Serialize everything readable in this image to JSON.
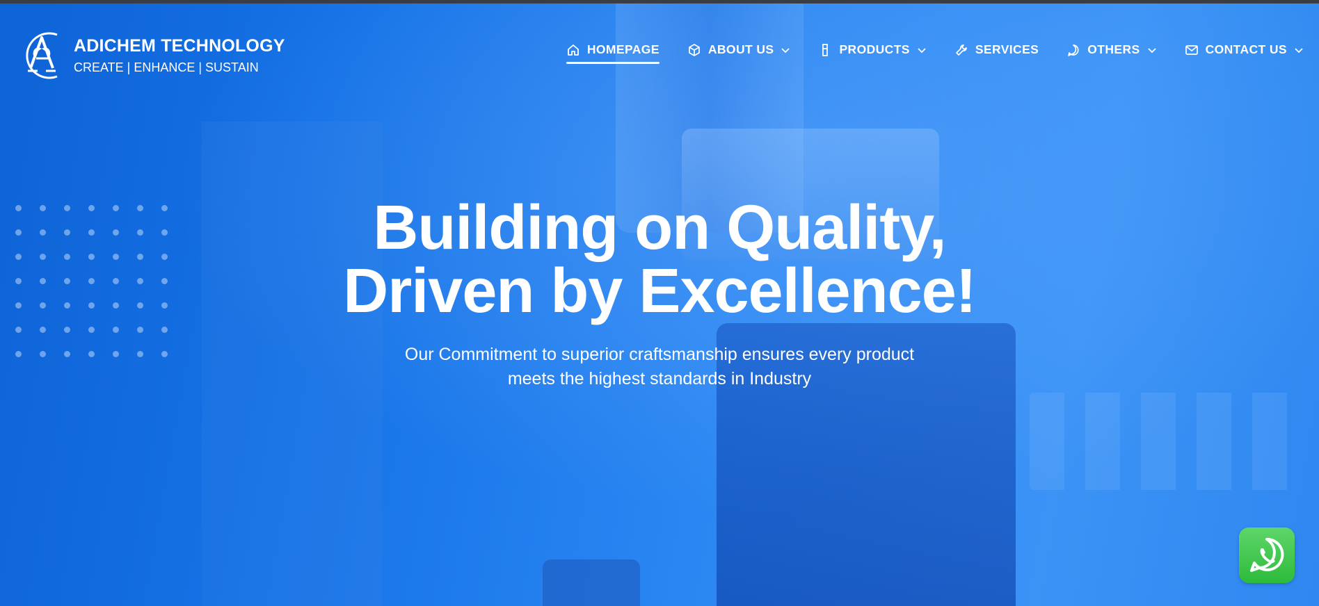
{
  "brand": {
    "name": "ADICHEM TECHNOLOGY",
    "tagline": "CREATE | ENHANCE | SUSTAIN",
    "logo_icon": "adichem-logo-icon"
  },
  "nav": {
    "items": [
      {
        "label": "HOMEPAGE",
        "icon": "home-icon",
        "dropdown": false,
        "active": true
      },
      {
        "label": "ABOUT US",
        "icon": "cube-icon",
        "dropdown": true,
        "active": false
      },
      {
        "label": "PRODUCTS",
        "icon": "flask-icon",
        "dropdown": true,
        "active": false
      },
      {
        "label": "SERVICES",
        "icon": "wrench-icon",
        "dropdown": false,
        "active": false
      },
      {
        "label": "OTHERS",
        "icon": "chat-bubble-icon",
        "dropdown": true,
        "active": false
      },
      {
        "label": "CONTACT US",
        "icon": "envelope-icon",
        "dropdown": true,
        "active": false
      }
    ]
  },
  "hero": {
    "headline_line1": "Building on Quality,",
    "headline_line2": "Driven by Excellence!",
    "subtext_line1": "Our Commitment to superior craftsmanship ensures every product",
    "subtext_line2": "meets the highest standards in Industry"
  },
  "floating": {
    "whatsapp_icon": "whatsapp-icon"
  },
  "colors": {
    "hero_blue": "#1b6fe0",
    "topbar": "#3a3d44",
    "whatsapp_green": "#2dbb3b",
    "text": "#ffffff"
  }
}
